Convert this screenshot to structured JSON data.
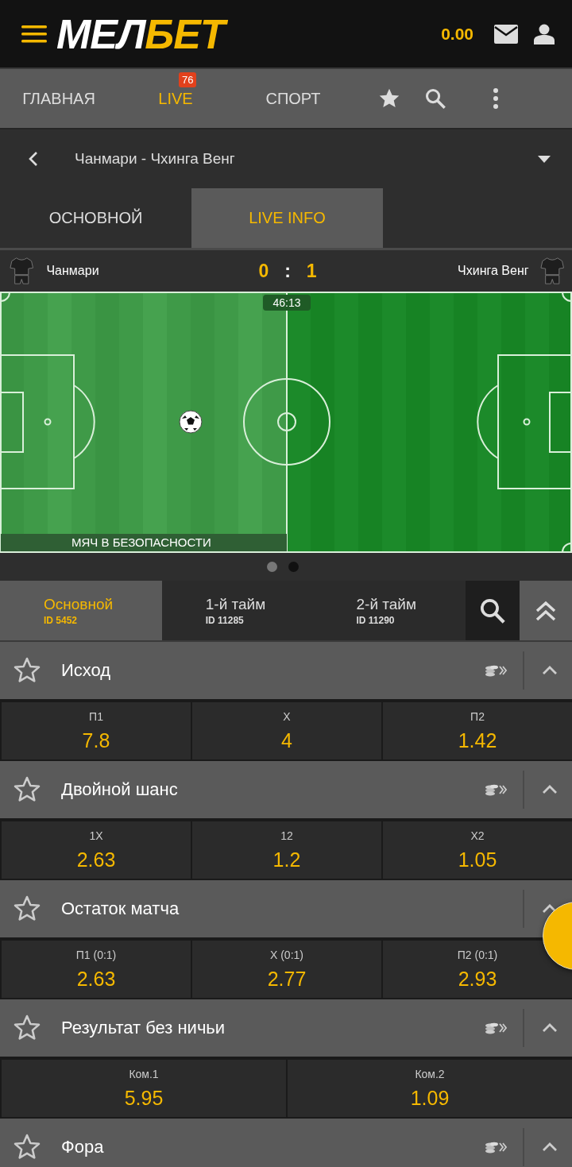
{
  "header": {
    "logo_white": "МЕЛ",
    "logo_yellow": "БЕТ",
    "balance": "0.00"
  },
  "nav": [
    {
      "label": "ГЛАВНАЯ",
      "selected": false
    },
    {
      "label": "LIVE",
      "selected": true,
      "badge": "76"
    },
    {
      "label": "СПОРТ",
      "selected": false
    }
  ],
  "match_bar": {
    "title": "Чанмари - Чхинга Венг"
  },
  "view_tabs": [
    {
      "label": "ОСНОВНОЙ",
      "selected": false
    },
    {
      "label": "LIVE INFO",
      "selected": true
    }
  ],
  "scoreboard": {
    "home": "Чанмари",
    "home_score": "0",
    "separator": ":",
    "away_score": "1",
    "away": "Чхинга Венг"
  },
  "pitch": {
    "time": "46:13",
    "status": "МЯЧ В БЕЗОПАСНОСТИ"
  },
  "carousel_dots": [
    {
      "selected": true
    },
    {
      "selected": false
    }
  ],
  "market_tabs": [
    {
      "label": "Основной",
      "id": "ID 5452",
      "selected": true
    },
    {
      "label": "1-й тайм",
      "id": "ID 11285",
      "selected": false
    },
    {
      "label": "2-й тайм",
      "id": "ID 11290",
      "selected": false
    }
  ],
  "markets": [
    {
      "title": "Исход",
      "favorite": false,
      "coupon_icon": true,
      "odds": [
        {
          "label": "П1",
          "value": "7.8"
        },
        {
          "label": "X",
          "value": "4"
        },
        {
          "label": "П2",
          "value": "1.42"
        }
      ]
    },
    {
      "title": "Двойной шанс",
      "favorite": false,
      "coupon_icon": true,
      "odds": [
        {
          "label": "1X",
          "value": "2.63"
        },
        {
          "label": "12",
          "value": "1.2"
        },
        {
          "label": "X2",
          "value": "1.05"
        }
      ]
    },
    {
      "title": "Остаток матча",
      "favorite": false,
      "coupon_icon": false,
      "odds": [
        {
          "label": "П1 (0:1)",
          "value": "2.63"
        },
        {
          "label": "X (0:1)",
          "value": "2.77"
        },
        {
          "label": "П2 (0:1)",
          "value": "2.93"
        }
      ]
    },
    {
      "title": "Результат без ничьи",
      "favorite": false,
      "coupon_icon": true,
      "odds": [
        {
          "label": "Ком.1",
          "value": "5.95"
        },
        {
          "label": "Ком.2",
          "value": "1.09"
        }
      ]
    },
    {
      "title": "Фора",
      "favorite": false,
      "coupon_icon": true
    }
  ]
}
